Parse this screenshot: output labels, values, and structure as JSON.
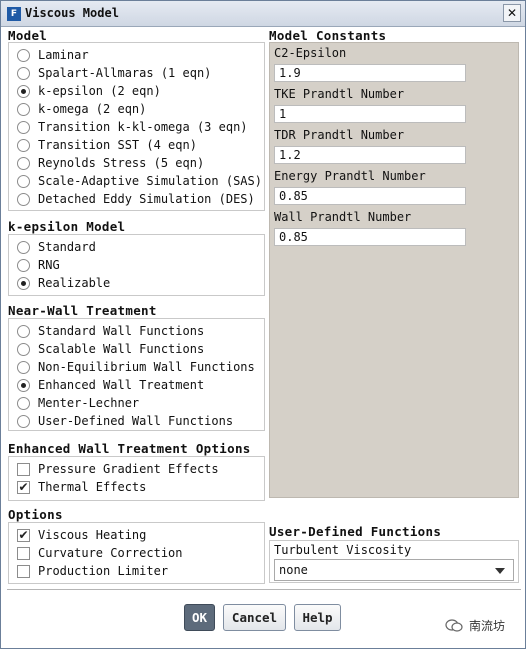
{
  "window": {
    "title": "Viscous Model",
    "icon_letter": "F",
    "close_glyph": "✕"
  },
  "model": {
    "title": "Model",
    "options": [
      {
        "label": "Laminar",
        "selected": false
      },
      {
        "label": "Spalart-Allmaras (1 eqn)",
        "selected": false
      },
      {
        "label": "k-epsilon (2 eqn)",
        "selected": true
      },
      {
        "label": "k-omega (2 eqn)",
        "selected": false
      },
      {
        "label": "Transition k-kl-omega (3 eqn)",
        "selected": false
      },
      {
        "label": "Transition SST (4 eqn)",
        "selected": false
      },
      {
        "label": "Reynolds Stress (5 eqn)",
        "selected": false
      },
      {
        "label": "Scale-Adaptive Simulation (SAS)",
        "selected": false
      },
      {
        "label": "Detached Eddy Simulation (DES)",
        "selected": false
      }
    ]
  },
  "kepsilon": {
    "title": "k-epsilon Model",
    "options": [
      {
        "label": "Standard",
        "selected": false
      },
      {
        "label": "RNG",
        "selected": false
      },
      {
        "label": "Realizable",
        "selected": true
      }
    ]
  },
  "nearwall": {
    "title": "Near-Wall Treatment",
    "options": [
      {
        "label": "Standard Wall Functions",
        "selected": false
      },
      {
        "label": "Scalable Wall Functions",
        "selected": false
      },
      {
        "label": "Non-Equilibrium Wall Functions",
        "selected": false
      },
      {
        "label": "Enhanced Wall Treatment",
        "selected": true
      },
      {
        "label": "Menter-Lechner",
        "selected": false
      },
      {
        "label": "User-Defined Wall Functions",
        "selected": false
      }
    ]
  },
  "ewt_options": {
    "title": "Enhanced Wall Treatment Options",
    "items": [
      {
        "label": "Pressure Gradient Effects",
        "checked": false
      },
      {
        "label": "Thermal Effects",
        "checked": true
      }
    ]
  },
  "options": {
    "title": "Options",
    "items": [
      {
        "label": "Viscous Heating",
        "checked": true
      },
      {
        "label": "Curvature Correction",
        "checked": false
      },
      {
        "label": "Production Limiter",
        "checked": false
      }
    ]
  },
  "constants": {
    "title": "Model Constants",
    "fields": [
      {
        "label": "C2-Epsilon",
        "value": "1.9"
      },
      {
        "label": "TKE Prandtl Number",
        "value": "1"
      },
      {
        "label": "TDR Prandtl Number",
        "value": "1.2"
      },
      {
        "label": "Energy Prandtl Number",
        "value": "0.85"
      },
      {
        "label": "Wall Prandtl Number",
        "value": "0.85"
      }
    ]
  },
  "udf": {
    "title": "User-Defined Functions",
    "turbulent_viscosity_label": "Turbulent Viscosity",
    "turbulent_viscosity_value": "none"
  },
  "buttons": {
    "ok": "OK",
    "cancel": "Cancel",
    "help": "Help"
  },
  "watermark": {
    "text": "南流坊"
  },
  "check_glyph": "✔"
}
